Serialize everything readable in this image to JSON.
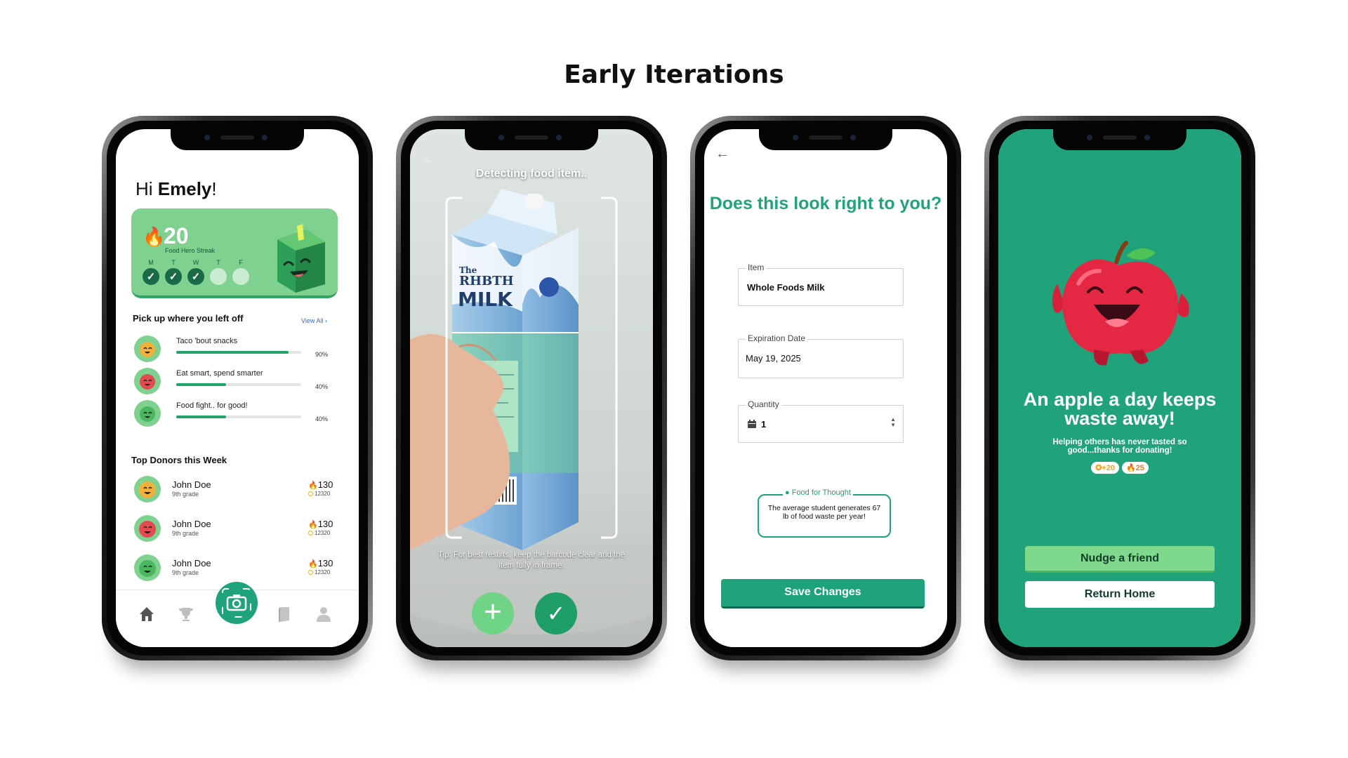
{
  "page_title": "Early Iterations",
  "colors": {
    "brand_green": "#1fa37a",
    "light_green": "#7fd18f",
    "flame_orange": "#f57c1f"
  },
  "home": {
    "greeting_prefix": "Hi ",
    "user_name": "Emely",
    "greeting_suffix": "!",
    "streak": {
      "count": "20",
      "label": "Food Hero Streak",
      "days": [
        {
          "label": "M",
          "done": true
        },
        {
          "label": "T",
          "done": true
        },
        {
          "label": "W",
          "done": true
        },
        {
          "label": "T",
          "done": false
        },
        {
          "label": "F",
          "done": false
        }
      ]
    },
    "continue_heading": "Pick up where you left off",
    "view_all": "View All ›",
    "courses": [
      {
        "title": "Taco 'bout snacks",
        "progress_pct": "90%",
        "progress": 0.9
      },
      {
        "title": "Eat smart, spend smarter",
        "progress_pct": "40%",
        "progress": 0.4
      },
      {
        "title": "Food fight.. for good!",
        "progress_pct": "40%",
        "progress": 0.4
      }
    ],
    "donors_heading": "Top Donors this Week",
    "donors": [
      {
        "name": "John Doe",
        "grade": "9th grade",
        "score": "130",
        "points": "12320"
      },
      {
        "name": "John Doe",
        "grade": "9th grade",
        "score": "130",
        "points": "12320"
      },
      {
        "name": "John Doe",
        "grade": "9th grade",
        "score": "130",
        "points": "12320"
      }
    ],
    "nav_icons": [
      "home-icon",
      "trophy-icon",
      "camera-icon",
      "book-icon",
      "profile-icon"
    ]
  },
  "scan": {
    "status": "Detecting food item..",
    "tip": "Tip: For best results, keep the barcode clear and the item fully in frame.",
    "carton_brand_small": "The",
    "carton_brand": "RHBTH",
    "carton_product": "MILK"
  },
  "confirm": {
    "title": "Does this look right to you?",
    "fields": {
      "item_label": "Item",
      "item_value": "Whole Foods Milk",
      "expiration_label": "Expiration Date",
      "expiration_value": "May 19, 2025",
      "quantity_label": "Quantity",
      "quantity_value": "1"
    },
    "food_for_thought_label": "Food for Thought",
    "food_for_thought_text": "The average student generates 67 lb of food waste per year!",
    "save_label": "Save Changes"
  },
  "success": {
    "headline": "An apple a day keeps waste away!",
    "subtext": "Helping others has never tasted so good...thanks for donating!",
    "badge_points": "+20",
    "badge_streak": "25",
    "nudge_label": "Nudge a friend",
    "home_label": "Return Home"
  }
}
